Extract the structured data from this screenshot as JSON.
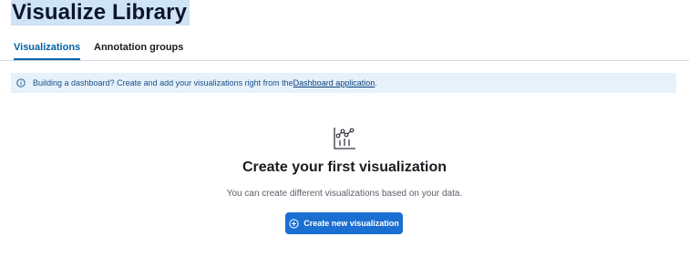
{
  "header": {
    "title": "Visualize Library"
  },
  "tabs": [
    {
      "label": "Visualizations",
      "selected": true
    },
    {
      "label": "Annotation groups",
      "selected": false
    }
  ],
  "callout": {
    "icon": "info-icon",
    "text": "Building a dashboard? Create and add your visualizations right from the ",
    "link_label": "Dashboard application",
    "suffix": "."
  },
  "empty_state": {
    "icon": "visualize-app-icon",
    "title": "Create your first visualization",
    "body": "You can create different visualizations based on your data.",
    "button_label": "Create new visualization",
    "button_icon": "plus-in-circle-icon"
  },
  "colors": {
    "accent": "#0061a6",
    "button": "#1a6fd1",
    "callout_bg": "#e6f1fa",
    "title_highlight": "#cfe3f6"
  }
}
